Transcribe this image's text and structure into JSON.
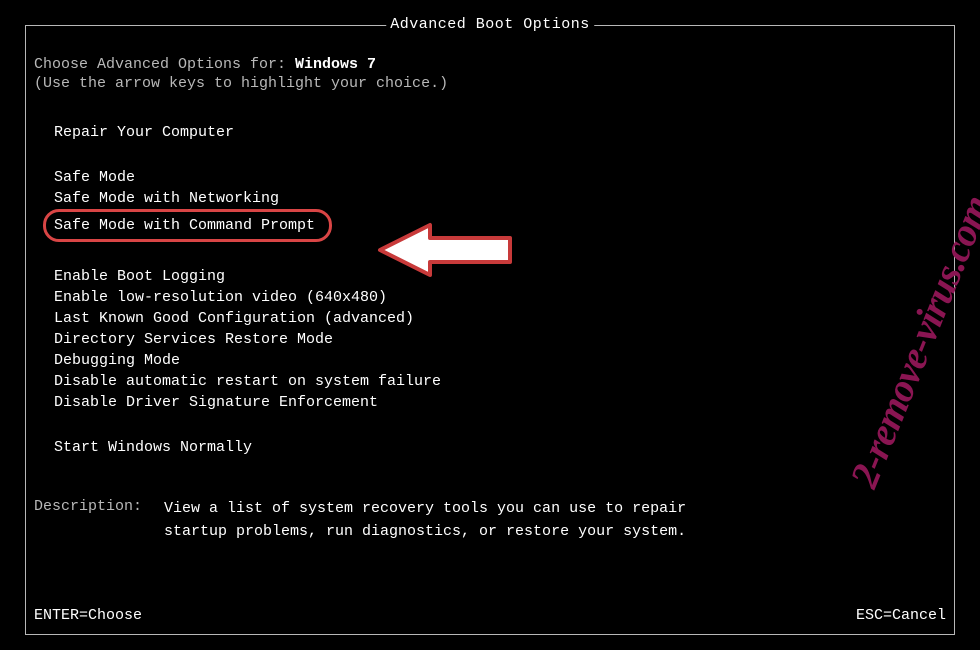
{
  "title": "Advanced Boot Options",
  "choose_prefix": "Choose Advanced Options for: ",
  "os_name": "Windows 7",
  "instruction": "(Use the arrow keys to highlight your choice.)",
  "groups": {
    "repair": [
      "Repair Your Computer"
    ],
    "safe_modes": [
      "Safe Mode",
      "Safe Mode with Networking",
      "Safe Mode with Command Prompt"
    ],
    "advanced": [
      "Enable Boot Logging",
      "Enable low-resolution video (640x480)",
      "Last Known Good Configuration (advanced)",
      "Directory Services Restore Mode",
      "Debugging Mode",
      "Disable automatic restart on system failure",
      "Disable Driver Signature Enforcement"
    ],
    "normal": [
      "Start Windows Normally"
    ]
  },
  "description": {
    "label": "Description:",
    "line1": "View a list of system recovery tools you can use to repair",
    "line2": "startup problems, run diagnostics, or restore your system."
  },
  "footer": {
    "enter": "ENTER=Choose",
    "esc": "ESC=Cancel"
  },
  "watermark": "2-remove-virus.com"
}
